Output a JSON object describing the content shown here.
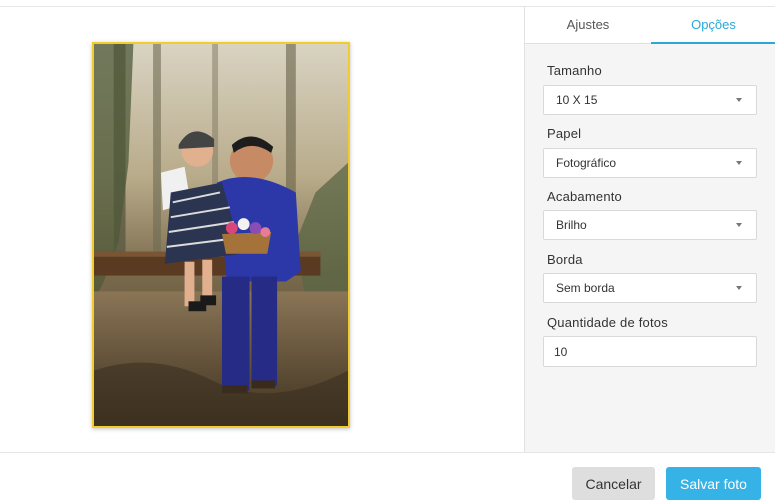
{
  "tabs": [
    {
      "label": "Ajustes",
      "active": false
    },
    {
      "label": "Opções",
      "active": true
    }
  ],
  "options": {
    "size": {
      "label": "Tamanho",
      "value": "10 X 15"
    },
    "paper": {
      "label": "Papel",
      "value": "Fotográfico"
    },
    "finish": {
      "label": "Acabamento",
      "value": "Brilho"
    },
    "border": {
      "label": "Borda",
      "value": "Sem borda"
    },
    "quantity": {
      "label": "Quantidade de fotos",
      "value": "10"
    }
  },
  "footer": {
    "cancel_label": "Cancelar",
    "save_label": "Salvar foto"
  },
  "colors": {
    "accent": "#36b3e6",
    "frame_border": "#f2cc2c"
  },
  "icons": {
    "dropdown": "caret-down-icon"
  }
}
